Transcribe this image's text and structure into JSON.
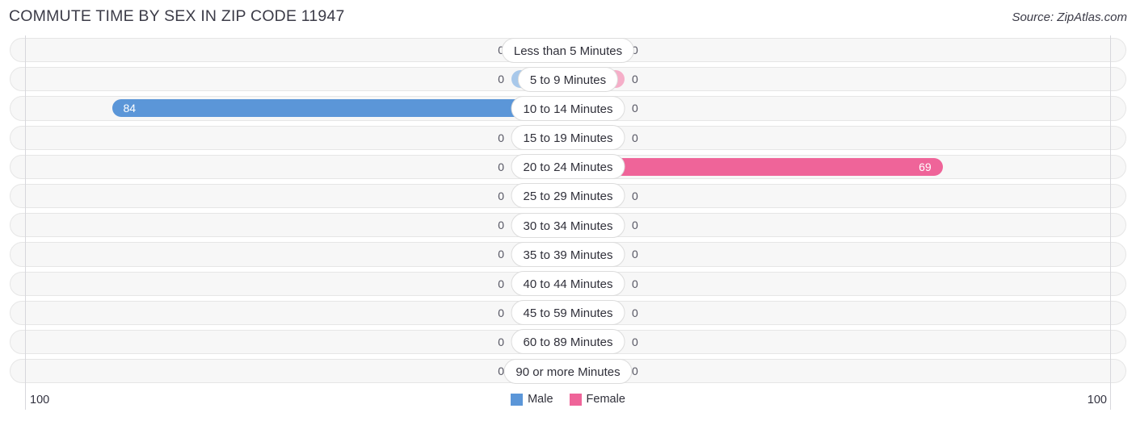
{
  "header": {
    "title": "COMMUTE TIME BY SEX IN ZIP CODE 11947",
    "source": "Source: ZipAtlas.com"
  },
  "legend": {
    "male_label": "Male",
    "female_label": "Female",
    "male_color": "#5b96d8",
    "female_color": "#ef6499"
  },
  "axis": {
    "left_label": "100",
    "right_label": "100",
    "max": 100
  },
  "colors": {
    "male": "#5b96d8",
    "female": "#ef6499",
    "male_zero": "#a8c8ea",
    "female_zero": "#f5aec8",
    "track": "#f7f7f7"
  },
  "chart_data": {
    "type": "bar",
    "title": "COMMUTE TIME BY SEX IN ZIP CODE 11947",
    "xlabel": "",
    "ylabel": "",
    "orientation": "horizontal",
    "layout": "diverging-bidirectional",
    "legend_position": "bottom-center",
    "grid": false,
    "xlim": [
      100,
      100
    ],
    "axis_left_max": 100,
    "axis_right_max": 100,
    "categories": [
      "Less than 5 Minutes",
      "5 to 9 Minutes",
      "10 to 14 Minutes",
      "15 to 19 Minutes",
      "20 to 24 Minutes",
      "25 to 29 Minutes",
      "30 to 34 Minutes",
      "35 to 39 Minutes",
      "40 to 44 Minutes",
      "45 to 59 Minutes",
      "60 to 89 Minutes",
      "90 or more Minutes"
    ],
    "series": [
      {
        "name": "Male",
        "color": "#5b96d8",
        "values": [
          0,
          0,
          84,
          0,
          0,
          0,
          0,
          0,
          0,
          0,
          0,
          0
        ]
      },
      {
        "name": "Female",
        "color": "#ef6499",
        "values": [
          0,
          0,
          0,
          0,
          69,
          0,
          0,
          0,
          0,
          0,
          0,
          0
        ]
      }
    ]
  },
  "rows": [
    {
      "label": "Less than 5 Minutes",
      "male": 0,
      "female": 0,
      "male_text": "0",
      "female_text": "0"
    },
    {
      "label": "5 to 9 Minutes",
      "male": 0,
      "female": 0,
      "male_text": "0",
      "female_text": "0"
    },
    {
      "label": "10 to 14 Minutes",
      "male": 84,
      "female": 0,
      "male_text": "84",
      "female_text": "0"
    },
    {
      "label": "15 to 19 Minutes",
      "male": 0,
      "female": 0,
      "male_text": "0",
      "female_text": "0"
    },
    {
      "label": "20 to 24 Minutes",
      "male": 0,
      "female": 69,
      "male_text": "0",
      "female_text": "69"
    },
    {
      "label": "25 to 29 Minutes",
      "male": 0,
      "female": 0,
      "male_text": "0",
      "female_text": "0"
    },
    {
      "label": "30 to 34 Minutes",
      "male": 0,
      "female": 0,
      "male_text": "0",
      "female_text": "0"
    },
    {
      "label": "35 to 39 Minutes",
      "male": 0,
      "female": 0,
      "male_text": "0",
      "female_text": "0"
    },
    {
      "label": "40 to 44 Minutes",
      "male": 0,
      "female": 0,
      "male_text": "0",
      "female_text": "0"
    },
    {
      "label": "45 to 59 Minutes",
      "male": 0,
      "female": 0,
      "male_text": "0",
      "female_text": "0"
    },
    {
      "label": "60 to 89 Minutes",
      "male": 0,
      "female": 0,
      "male_text": "0",
      "female_text": "0"
    },
    {
      "label": "90 or more Minutes",
      "male": 0,
      "female": 0,
      "male_text": "0",
      "female_text": "0"
    }
  ]
}
